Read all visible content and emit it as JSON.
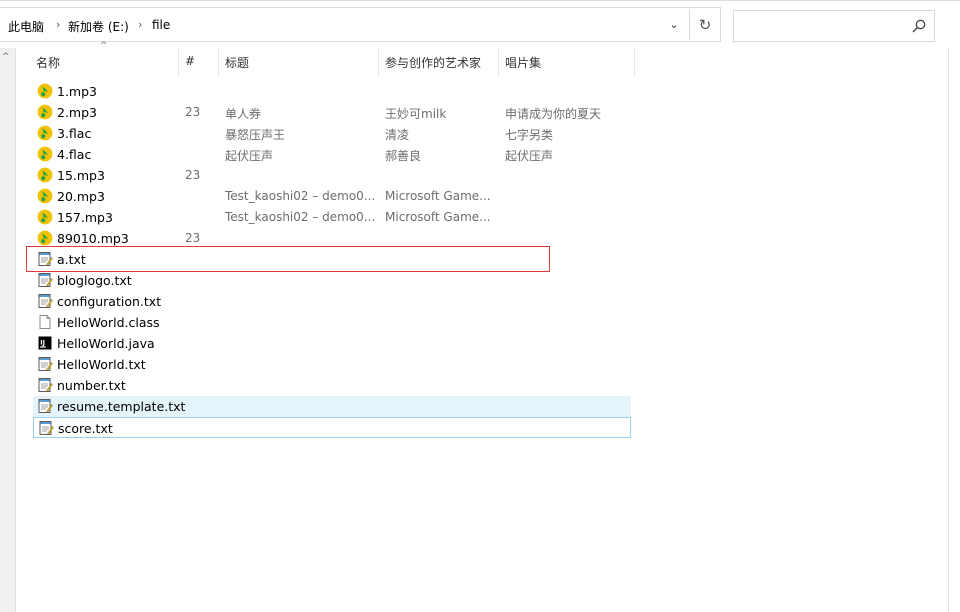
{
  "breadcrumb": {
    "items": [
      "此电脑",
      "新加卷 (E:)",
      "file"
    ],
    "separator": "›"
  },
  "address_bar": {
    "dropdown_glyph": "⌄",
    "refresh_glyph": "↻"
  },
  "search": {
    "placeholder": "",
    "icon": "search-icon"
  },
  "nav_pane": {
    "collapse_glyph": "^"
  },
  "columns": {
    "name": "名称",
    "track": "#",
    "title": "标题",
    "artist": "参与创作的艺术家",
    "album": "唱片集",
    "sort_glyph": "^"
  },
  "files": [
    {
      "name": "1.mp3",
      "icon": "music-file-icon",
      "track": "",
      "title": "",
      "artist": "",
      "album": ""
    },
    {
      "name": "2.mp3",
      "icon": "music-file-icon",
      "track": "23",
      "title": "单人券",
      "artist": "王妙可milk",
      "album": "申请成为你的夏天"
    },
    {
      "name": "3.flac",
      "icon": "music-file-icon",
      "track": "",
      "title": "暴怒压声王",
      "artist": "清凌",
      "album": "七字另类"
    },
    {
      "name": "4.flac",
      "icon": "music-file-icon",
      "track": "",
      "title": "起伏压声",
      "artist": "郝善良",
      "album": "起伏压声"
    },
    {
      "name": "15.mp3",
      "icon": "music-file-icon",
      "track": "23",
      "title": "",
      "artist": "",
      "album": ""
    },
    {
      "name": "20.mp3",
      "icon": "music-file-icon",
      "track": "",
      "title": "Test_kaoshi02 – demo0...",
      "artist": "Microsoft Game...",
      "album": ""
    },
    {
      "name": "157.mp3",
      "icon": "music-file-icon",
      "track": "",
      "title": "Test_kaoshi02 – demo0...",
      "artist": "Microsoft Game...",
      "album": ""
    },
    {
      "name": "89010.mp3",
      "icon": "music-file-icon",
      "track": "23",
      "title": "",
      "artist": "",
      "album": ""
    },
    {
      "name": "a.txt",
      "icon": "text-file-icon",
      "track": "",
      "title": "",
      "artist": "",
      "album": ""
    },
    {
      "name": "bloglogo.txt",
      "icon": "text-file-icon",
      "track": "",
      "title": "",
      "artist": "",
      "album": ""
    },
    {
      "name": "configuration.txt",
      "icon": "text-file-icon",
      "track": "",
      "title": "",
      "artist": "",
      "album": ""
    },
    {
      "name": "HelloWorld.class",
      "icon": "blank-file-icon",
      "track": "",
      "title": "",
      "artist": "",
      "album": ""
    },
    {
      "name": "HelloWorld.java",
      "icon": "intellij-file-icon",
      "track": "",
      "title": "",
      "artist": "",
      "album": ""
    },
    {
      "name": "HelloWorld.txt",
      "icon": "text-file-icon",
      "track": "",
      "title": "",
      "artist": "",
      "album": ""
    },
    {
      "name": "number.txt",
      "icon": "text-file-icon",
      "track": "",
      "title": "",
      "artist": "",
      "album": ""
    },
    {
      "name": "resume.template.txt",
      "icon": "text-file-icon",
      "track": "",
      "title": "",
      "artist": "",
      "album": ""
    },
    {
      "name": "score.txt",
      "icon": "text-file-icon",
      "track": "",
      "title": "",
      "artist": "",
      "album": ""
    }
  ],
  "colors": {
    "hover_row": "#e5f3fb",
    "focus_border": "#99d1ef",
    "highlight_box": "#e03c3c",
    "music_icon_yellow": "#f2c200",
    "music_icon_green": "#1aa34a"
  }
}
